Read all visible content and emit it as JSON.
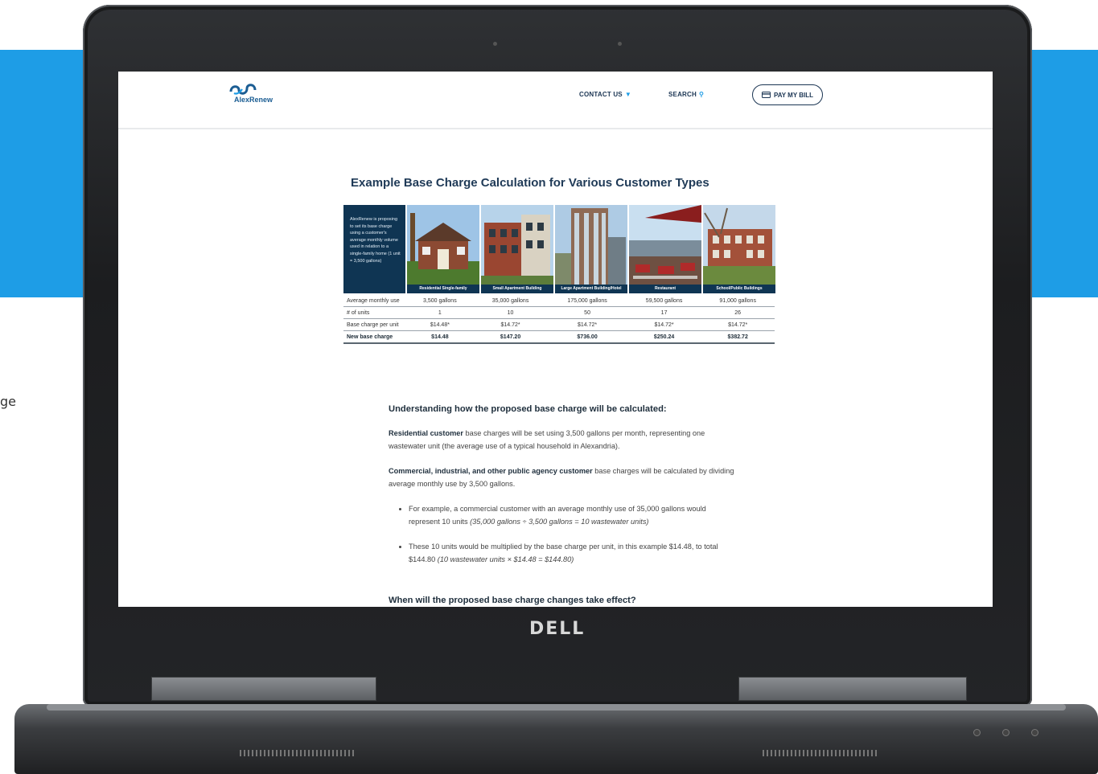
{
  "background": {
    "side_text": "ge",
    "band_color": "#1e9de6"
  },
  "device": {
    "brand": "DELL"
  },
  "site": {
    "logo_text": "AlexRenew",
    "nav": {
      "contact": "CONTACT US",
      "search": "SEARCH",
      "pay": "PAY MY BILL"
    },
    "accent": "#1e9de6",
    "navy": "#0f3553"
  },
  "section_title": "Example Base Charge Calculation for Various Customer Types",
  "promo": {
    "intro": "AlexRenew is proposing to set its base charge using a customer's average monthly volume used in relation to a single-family home (1 unit = 3,500 gallons)",
    "photos": [
      "Residential Single-family",
      "Small Apartment Building",
      "Large Apartment Building/Hotel",
      "Restaurant",
      "School/Public Buildings"
    ]
  },
  "table": {
    "rows": [
      {
        "label": "Average monthly use",
        "values": [
          "3,500 gallons",
          "35,000 gallons",
          "175,000 gallons",
          "59,500 gallons",
          "91,000 gallons"
        ]
      },
      {
        "label": "# of units",
        "values": [
          "1",
          "10",
          "50",
          "17",
          "26"
        ]
      },
      {
        "label": "Base charge per unit",
        "values": [
          "$14.48*",
          "$14.72*",
          "$14.72*",
          "$14.72*",
          "$14.72*"
        ]
      },
      {
        "label": "New base charge",
        "values": [
          "$14.48",
          "$147.20",
          "$736.00",
          "$250.24",
          "$382.72"
        ]
      }
    ]
  },
  "explain": {
    "heading": "Understanding how the proposed base charge will be calculated:",
    "p1_bold": "Residential customer",
    "p1_rest": " base charges will be set using 3,500 gallons per month, representing one wastewater unit (the average use of a typical household in Alexandria).",
    "p2_bold": "Commercial, industrial, and other public agency customer",
    "p2_rest": " base charges will be calculated by dividing average monthly use by 3,500 gallons.",
    "b1_text": "For example, a commercial customer with an average monthly use of 35,000 gallons would represent 10 units ",
    "b1_ital": "(35,000 gallons ÷ 3,500 gallons = 10 wastewater units)",
    "b2_text": "These 10 units would be multiplied by the base charge per unit, in this example $14.48, to total $144.80 ",
    "b2_ital": "(10 wastewater units × $14.48 = $144.80)",
    "heading2": "When will the proposed base charge changes take effect?"
  }
}
